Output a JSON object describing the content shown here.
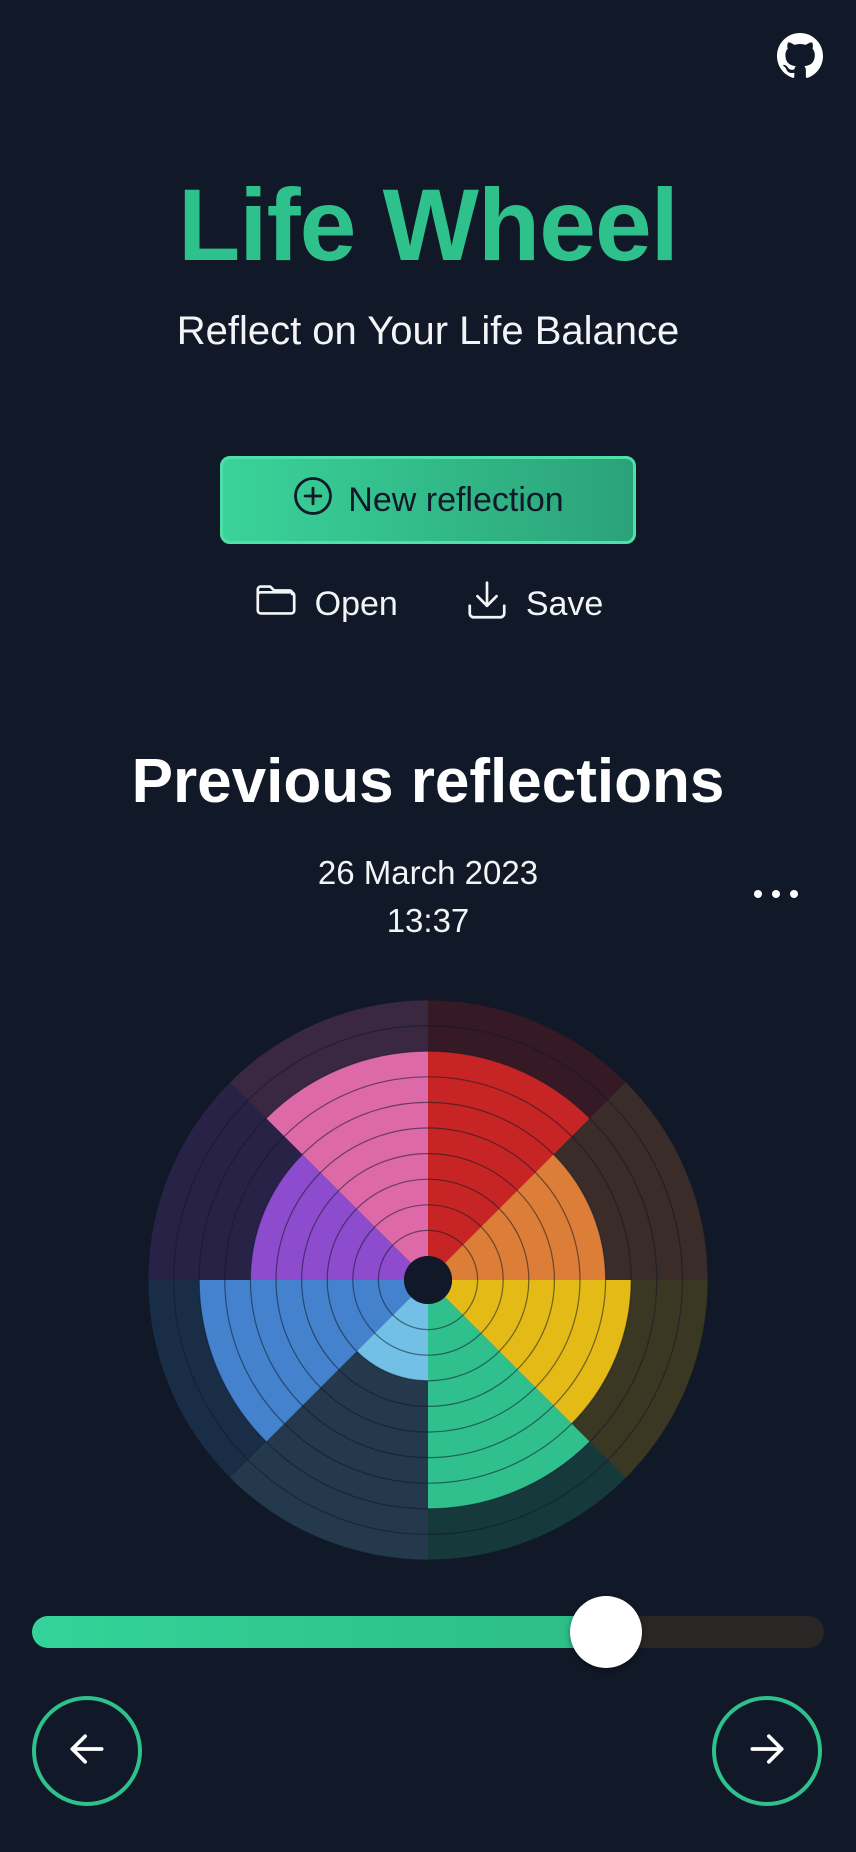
{
  "header": {
    "github_icon": "github-icon",
    "title": "Life Wheel",
    "subtitle": "Reflect on Your Life Balance"
  },
  "actions": {
    "new_label": "New reflection",
    "new_icon": "plus-circle-icon",
    "open_label": "Open",
    "open_icon": "folder-icon",
    "save_label": "Save",
    "save_icon": "download-icon"
  },
  "previous": {
    "heading": "Previous reflections",
    "date": "26 March 2023",
    "time": "13:37",
    "more_icon": "more-horizontal-icon"
  },
  "wheel": {
    "max_level": 10,
    "segments": [
      {
        "color": "#dc2626",
        "value": 8
      },
      {
        "color": "#f2893a",
        "value": 6
      },
      {
        "color": "#facc15",
        "value": 7
      },
      {
        "color": "#34d399",
        "value": 8
      },
      {
        "color": "#7dd3fc",
        "value": 3
      },
      {
        "color": "#4a8ee0",
        "value": 8
      },
      {
        "color": "#9b51e0",
        "value": 6
      },
      {
        "color": "#f472b6",
        "value": 8
      }
    ]
  },
  "timeline": {
    "position_fraction": 0.725,
    "accent": "#34d399",
    "prev_icon": "arrow-left-icon",
    "next_icon": "arrow-right-icon"
  }
}
